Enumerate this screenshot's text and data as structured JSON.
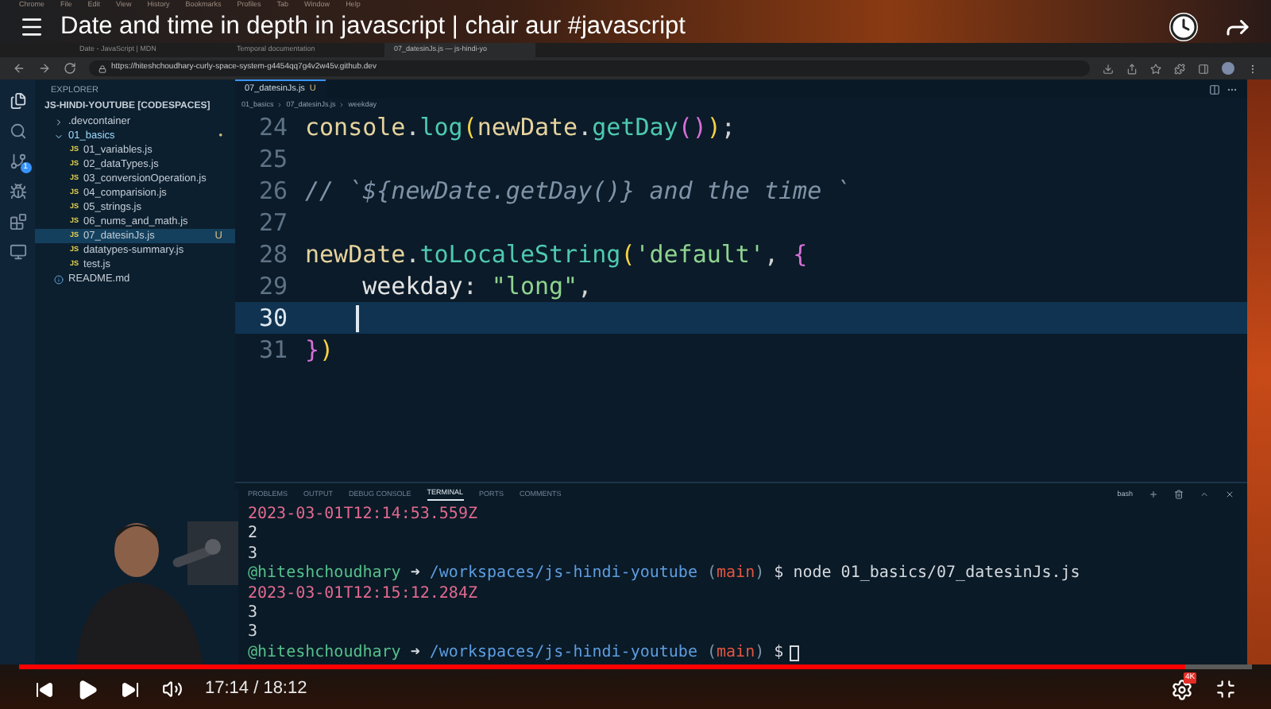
{
  "menu_bar": [
    "Chrome",
    "File",
    "Edit",
    "View",
    "History",
    "Bookmarks",
    "Profiles",
    "Tab",
    "Window",
    "Help"
  ],
  "video_title": "Date and time in depth in javascript | chair aur #javascript",
  "browser_tabs": [
    {
      "title": "Date - JavaScript | MDN",
      "selected": false
    },
    {
      "title": "Temporal documentation",
      "selected": false
    },
    {
      "title": "07_datesinJs.js — js-hindi-yo",
      "selected": true
    }
  ],
  "address": "https://hiteshchoudhary-curly-space-system-g4454qq7g4v2w45v.github.dev",
  "activity_badge": "1",
  "explorer": {
    "title": "EXPLORER",
    "root": "JS-HINDI-YOUTUBE [CODESPACES]",
    "tree": [
      {
        "name": ".devcontainer",
        "kind": "folder",
        "expanded": false
      },
      {
        "name": "01_basics",
        "kind": "folder",
        "expanded": true,
        "badge": "•",
        "children": [
          {
            "name": "01_variables.js",
            "kind": "js",
            "icon_text": "JS",
            "selected": false
          },
          {
            "name": "02_dataTypes.js",
            "kind": "js",
            "icon_text": "JS",
            "selected": false
          },
          {
            "name": "03_conversionOperation.js",
            "kind": "js",
            "icon_text": "JS",
            "selected": false
          },
          {
            "name": "04_comparision.js",
            "kind": "js",
            "icon_text": "JS",
            "selected": false
          },
          {
            "name": "05_strings.js",
            "kind": "js",
            "icon_text": "JS",
            "selected": false
          },
          {
            "name": "06_nums_and_math.js",
            "kind": "js",
            "icon_text": "JS",
            "selected": false
          },
          {
            "name": "07_datesinJs.js",
            "kind": "js",
            "icon_text": "JS",
            "selected": true,
            "badge": "U"
          },
          {
            "name": "datatypes-summary.js",
            "kind": "js",
            "icon_text": "JS",
            "selected": false
          },
          {
            "name": "test.js",
            "kind": "js",
            "icon_text": "JS",
            "selected": false
          }
        ]
      },
      {
        "name": "README.md",
        "kind": "info"
      }
    ]
  },
  "editor": {
    "tab": {
      "title": "07_datesinJs.js",
      "badge": "U"
    },
    "breadcrumbs": [
      "01_basics",
      "07_datesinJs.js",
      "weekday"
    ],
    "lines": [
      {
        "number": "24",
        "selected": false,
        "tokens": [
          {
            "text": "console",
            "kind": "var"
          },
          {
            "text": ".",
            "kind": "punct"
          },
          {
            "text": "log",
            "kind": "fn"
          },
          {
            "text": "(",
            "kind": "paren"
          },
          {
            "text": "newDate",
            "kind": "var"
          },
          {
            "text": ".",
            "kind": "punct"
          },
          {
            "text": "getDay",
            "kind": "fn"
          },
          {
            "text": "()",
            "kind": "brace"
          },
          {
            "text": ")",
            "kind": "paren"
          },
          {
            "text": ";",
            "kind": "punct"
          }
        ]
      },
      {
        "number": "25",
        "selected": false
      },
      {
        "number": "26",
        "selected": false,
        "tokens": [
          {
            "text": "// `${newDate.getDay()} and the time `",
            "kind": "comment"
          }
        ]
      },
      {
        "number": "27",
        "selected": false
      },
      {
        "number": "28",
        "selected": false,
        "tokens": [
          {
            "text": "newDate",
            "kind": "var"
          },
          {
            "text": ".",
            "kind": "punct"
          },
          {
            "text": "toLocaleString",
            "kind": "fn"
          },
          {
            "text": "(",
            "kind": "paren"
          },
          {
            "text": "'default'",
            "kind": "str"
          },
          {
            "text": ", ",
            "kind": "punct"
          },
          {
            "text": "{",
            "kind": "brace"
          }
        ]
      },
      {
        "number": "29",
        "selected": false,
        "tokens": [
          {
            "text": "    weekday",
            "kind": "key"
          },
          {
            "text": ": ",
            "kind": "punct"
          },
          {
            "text": "\"long\"",
            "kind": "str"
          },
          {
            "text": ",",
            "kind": "punct"
          }
        ]
      },
      {
        "number": "30",
        "selected": true
      },
      {
        "number": "31",
        "selected": false,
        "tokens": [
          {
            "text": "}",
            "kind": "brace"
          },
          {
            "text": ")",
            "kind": "paren"
          }
        ]
      }
    ]
  },
  "panel": {
    "tabs": [
      {
        "label": "PROBLEMS",
        "selected": false
      },
      {
        "label": "OUTPUT",
        "selected": false
      },
      {
        "label": "DEBUG CONSOLE",
        "selected": false
      },
      {
        "label": "TERMINAL",
        "selected": true
      },
      {
        "label": "PORTS",
        "selected": false
      },
      {
        "label": "COMMENTS",
        "selected": false
      }
    ],
    "shell": "bash",
    "lines": [
      [
        {
          "text": "2023-03-01T12:14:53.559Z",
          "kind": "date"
        }
      ],
      [
        {
          "text": "2",
          "kind": "out"
        }
      ],
      [
        {
          "text": "3",
          "kind": "out"
        }
      ],
      [
        {
          "text": "@hiteshchoudhary",
          "kind": "user"
        },
        {
          "text": " ➜ ",
          "kind": "out"
        },
        {
          "text": "/workspaces/js-hindi-youtube",
          "kind": "path"
        },
        {
          "text": " (",
          "kind": "paren"
        },
        {
          "text": "main",
          "kind": "branch"
        },
        {
          "text": ")",
          "kind": "paren"
        },
        {
          "text": " $ node 01_basics/07_datesinJs.js",
          "kind": "out"
        }
      ],
      [
        {
          "text": "2023-03-01T12:15:12.284Z",
          "kind": "date"
        }
      ],
      [
        {
          "text": "3",
          "kind": "out"
        }
      ],
      [
        {
          "text": "3",
          "kind": "out"
        }
      ],
      [
        {
          "text": "@hiteshchoudhary",
          "kind": "user"
        },
        {
          "text": " ➜ ",
          "kind": "out"
        },
        {
          "text": "/workspaces/js-hindi-youtube",
          "kind": "path"
        },
        {
          "text": " (",
          "kind": "paren"
        },
        {
          "text": "main",
          "kind": "branch"
        },
        {
          "text": ")",
          "kind": "paren"
        },
        {
          "text": " $",
          "kind": "out"
        },
        {
          "kind": "cursor"
        }
      ]
    ]
  },
  "player": {
    "level": 0.946,
    "time": "17:14 / 18:12",
    "quality_badge": "4K"
  }
}
